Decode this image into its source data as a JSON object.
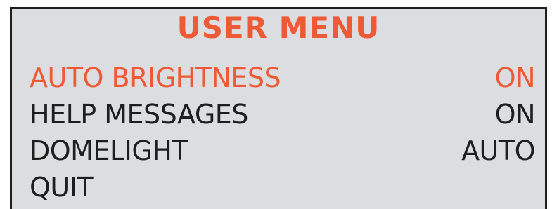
{
  "menu": {
    "title": "USER MENU",
    "items": [
      {
        "label": "AUTO BRIGHTNESS",
        "value": "ON",
        "selected": true
      },
      {
        "label": "HELP MESSAGES",
        "value": "ON",
        "selected": false
      },
      {
        "label": "DOMELIGHT",
        "value": "AUTO",
        "selected": false
      },
      {
        "label": "QUIT",
        "value": "",
        "selected": false
      }
    ]
  },
  "colors": {
    "panel_background": "#dcdde0",
    "title": "#ee5a36",
    "selected_item": "#ee5a36",
    "item_text": "#1e1e1e",
    "border": "#1e1e1e"
  }
}
